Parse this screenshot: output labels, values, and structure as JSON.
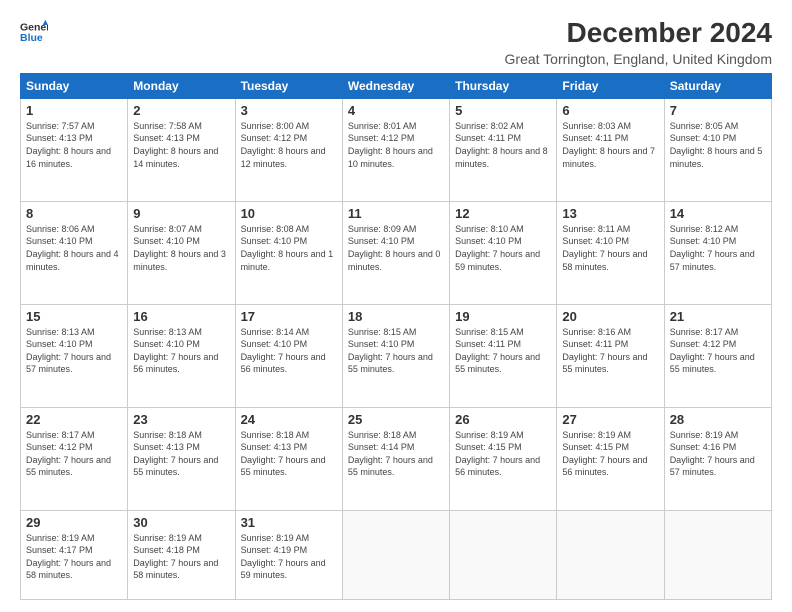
{
  "header": {
    "logo_line1": "General",
    "logo_line2": "Blue",
    "title": "December 2024",
    "subtitle": "Great Torrington, England, United Kingdom"
  },
  "columns": [
    "Sunday",
    "Monday",
    "Tuesday",
    "Wednesday",
    "Thursday",
    "Friday",
    "Saturday"
  ],
  "weeks": [
    [
      {
        "day": "1",
        "sunrise": "7:57 AM",
        "sunset": "4:13 PM",
        "daylight": "8 hours and 16 minutes."
      },
      {
        "day": "2",
        "sunrise": "7:58 AM",
        "sunset": "4:13 PM",
        "daylight": "8 hours and 14 minutes."
      },
      {
        "day": "3",
        "sunrise": "8:00 AM",
        "sunset": "4:12 PM",
        "daylight": "8 hours and 12 minutes."
      },
      {
        "day": "4",
        "sunrise": "8:01 AM",
        "sunset": "4:12 PM",
        "daylight": "8 hours and 10 minutes."
      },
      {
        "day": "5",
        "sunrise": "8:02 AM",
        "sunset": "4:11 PM",
        "daylight": "8 hours and 8 minutes."
      },
      {
        "day": "6",
        "sunrise": "8:03 AM",
        "sunset": "4:11 PM",
        "daylight": "8 hours and 7 minutes."
      },
      {
        "day": "7",
        "sunrise": "8:05 AM",
        "sunset": "4:10 PM",
        "daylight": "8 hours and 5 minutes."
      }
    ],
    [
      {
        "day": "8",
        "sunrise": "8:06 AM",
        "sunset": "4:10 PM",
        "daylight": "8 hours and 4 minutes."
      },
      {
        "day": "9",
        "sunrise": "8:07 AM",
        "sunset": "4:10 PM",
        "daylight": "8 hours and 3 minutes."
      },
      {
        "day": "10",
        "sunrise": "8:08 AM",
        "sunset": "4:10 PM",
        "daylight": "8 hours and 1 minute."
      },
      {
        "day": "11",
        "sunrise": "8:09 AM",
        "sunset": "4:10 PM",
        "daylight": "8 hours and 0 minutes."
      },
      {
        "day": "12",
        "sunrise": "8:10 AM",
        "sunset": "4:10 PM",
        "daylight": "7 hours and 59 minutes."
      },
      {
        "day": "13",
        "sunrise": "8:11 AM",
        "sunset": "4:10 PM",
        "daylight": "7 hours and 58 minutes."
      },
      {
        "day": "14",
        "sunrise": "8:12 AM",
        "sunset": "4:10 PM",
        "daylight": "7 hours and 57 minutes."
      }
    ],
    [
      {
        "day": "15",
        "sunrise": "8:13 AM",
        "sunset": "4:10 PM",
        "daylight": "7 hours and 57 minutes."
      },
      {
        "day": "16",
        "sunrise": "8:13 AM",
        "sunset": "4:10 PM",
        "daylight": "7 hours and 56 minutes."
      },
      {
        "day": "17",
        "sunrise": "8:14 AM",
        "sunset": "4:10 PM",
        "daylight": "7 hours and 56 minutes."
      },
      {
        "day": "18",
        "sunrise": "8:15 AM",
        "sunset": "4:10 PM",
        "daylight": "7 hours and 55 minutes."
      },
      {
        "day": "19",
        "sunrise": "8:15 AM",
        "sunset": "4:11 PM",
        "daylight": "7 hours and 55 minutes."
      },
      {
        "day": "20",
        "sunrise": "8:16 AM",
        "sunset": "4:11 PM",
        "daylight": "7 hours and 55 minutes."
      },
      {
        "day": "21",
        "sunrise": "8:17 AM",
        "sunset": "4:12 PM",
        "daylight": "7 hours and 55 minutes."
      }
    ],
    [
      {
        "day": "22",
        "sunrise": "8:17 AM",
        "sunset": "4:12 PM",
        "daylight": "7 hours and 55 minutes."
      },
      {
        "day": "23",
        "sunrise": "8:18 AM",
        "sunset": "4:13 PM",
        "daylight": "7 hours and 55 minutes."
      },
      {
        "day": "24",
        "sunrise": "8:18 AM",
        "sunset": "4:13 PM",
        "daylight": "7 hours and 55 minutes."
      },
      {
        "day": "25",
        "sunrise": "8:18 AM",
        "sunset": "4:14 PM",
        "daylight": "7 hours and 55 minutes."
      },
      {
        "day": "26",
        "sunrise": "8:19 AM",
        "sunset": "4:15 PM",
        "daylight": "7 hours and 56 minutes."
      },
      {
        "day": "27",
        "sunrise": "8:19 AM",
        "sunset": "4:15 PM",
        "daylight": "7 hours and 56 minutes."
      },
      {
        "day": "28",
        "sunrise": "8:19 AM",
        "sunset": "4:16 PM",
        "daylight": "7 hours and 57 minutes."
      }
    ],
    [
      {
        "day": "29",
        "sunrise": "8:19 AM",
        "sunset": "4:17 PM",
        "daylight": "7 hours and 58 minutes."
      },
      {
        "day": "30",
        "sunrise": "8:19 AM",
        "sunset": "4:18 PM",
        "daylight": "7 hours and 58 minutes."
      },
      {
        "day": "31",
        "sunrise": "8:19 AM",
        "sunset": "4:19 PM",
        "daylight": "7 hours and 59 minutes."
      },
      null,
      null,
      null,
      null
    ]
  ]
}
